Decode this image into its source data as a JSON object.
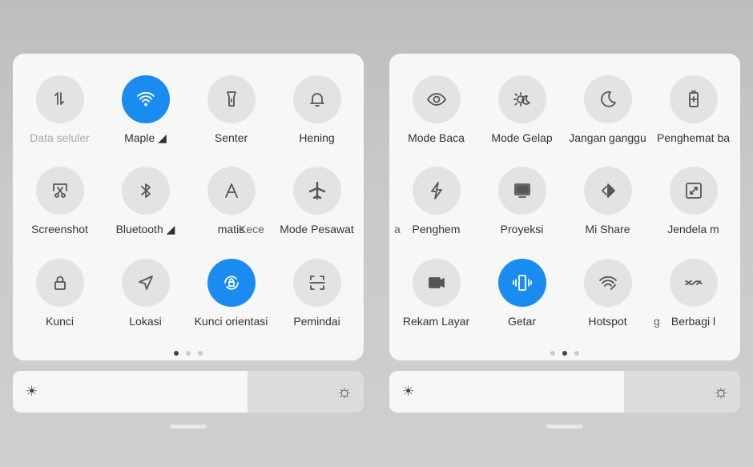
{
  "accent": "#1a8cf0",
  "brightness_percent": 67,
  "panels": [
    {
      "page_indicator": {
        "pages": 3,
        "current": 1
      },
      "tiles": [
        {
          "label": "Data seluler",
          "icon": "data-arrows-icon",
          "on": false,
          "dim": true
        },
        {
          "label": "Maple ◢",
          "icon": "wifi-icon",
          "on": true
        },
        {
          "label": "Senter",
          "icon": "flashlight-icon",
          "on": false
        },
        {
          "label": "Hening",
          "icon": "bell-icon",
          "on": false
        },
        {
          "label": "Screenshot",
          "icon": "scissors-screenshot-icon",
          "on": false
        },
        {
          "label": "Bluetooth ◢",
          "icon": "bluetooth-icon",
          "on": false
        },
        {
          "label": "matis",
          "icon": "auto-brightness-a-icon",
          "on": false
        },
        {
          "label": "Mode Pesawat",
          "icon": "airplane-icon",
          "on": false
        },
        {
          "label": "Kunci",
          "icon": "lock-icon",
          "on": false
        },
        {
          "label": "Lokasi",
          "icon": "location-arrow-icon",
          "on": false
        },
        {
          "label": "Kunci orientasi",
          "icon": "rotation-lock-icon",
          "on": true
        },
        {
          "label": "Pemindai",
          "icon": "scanner-icon",
          "on": false
        }
      ],
      "fragments": [
        "Kece"
      ]
    },
    {
      "page_indicator": {
        "pages": 3,
        "current": 2
      },
      "tiles": [
        {
          "label": "Mode Baca",
          "icon": "eye-icon",
          "on": false
        },
        {
          "label": "Mode Gelap",
          "icon": "dark-mode-icon",
          "on": false
        },
        {
          "label": "Jangan ganggu",
          "icon": "moon-icon",
          "on": false
        },
        {
          "label": "Penghemat ba",
          "icon": "battery-plus-icon",
          "on": false
        },
        {
          "label": "Penghem",
          "icon": "lightning-icon",
          "on": false
        },
        {
          "label": "Proyeksi",
          "icon": "monitor-icon",
          "on": false
        },
        {
          "label": "Mi Share",
          "icon": "mi-share-icon",
          "on": false
        },
        {
          "label": "Jendela m",
          "icon": "floating-window-icon",
          "on": false
        },
        {
          "label": "Rekam Layar",
          "icon": "video-camera-icon",
          "on": false
        },
        {
          "label": "Getar",
          "icon": "vibrate-icon",
          "on": true
        },
        {
          "label": "Hotspot",
          "icon": "hotspot-icon",
          "on": false
        },
        {
          "label": "Berbagi l",
          "icon": "share-link-icon",
          "on": false
        }
      ],
      "fragments": [
        "a",
        "g"
      ]
    }
  ]
}
